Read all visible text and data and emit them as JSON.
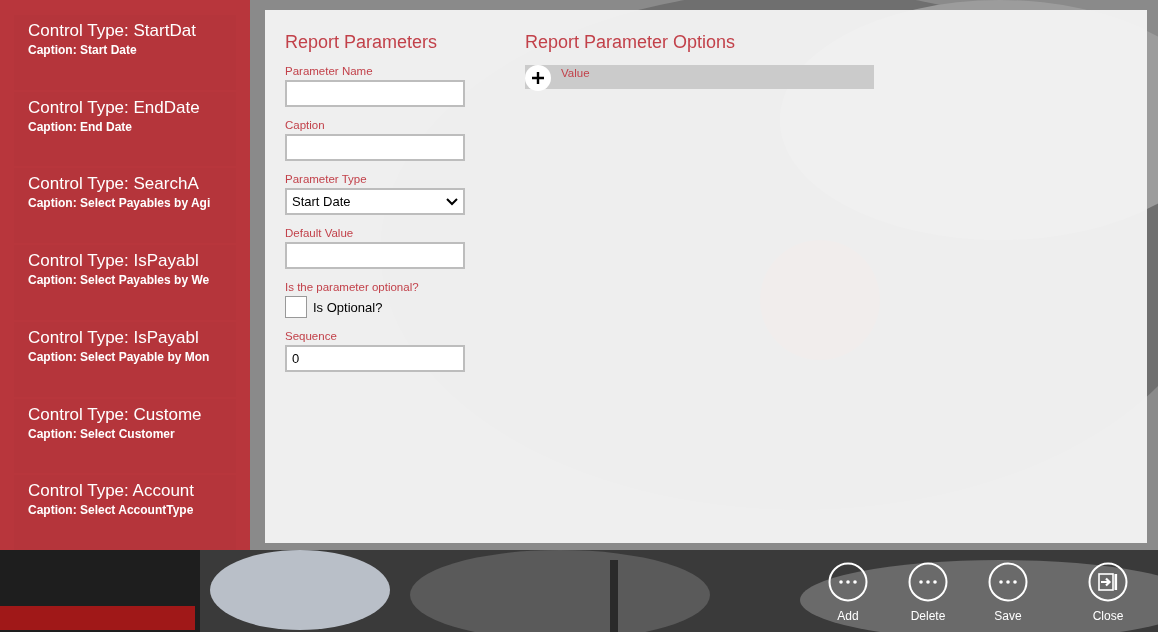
{
  "parameter_list": [
    {
      "control_type": "Control Type: StartDat",
      "caption": "Caption: Start Date",
      "selected": false
    },
    {
      "control_type": "Control Type: EndDate",
      "caption": "Caption: End Date",
      "selected": false
    },
    {
      "control_type": "Control Type: SearchA",
      "caption": "Caption: Select Payables by Agi",
      "selected": false
    },
    {
      "control_type": "Control Type: IsPayabl",
      "caption": "Caption: Select Payables by We",
      "selected": false
    },
    {
      "control_type": "Control Type: IsPayabl",
      "caption": "Caption: Select Payable by Mon",
      "selected": false
    },
    {
      "control_type": "Control Type: Custome",
      "caption": "Caption: Select Customer",
      "selected": false
    },
    {
      "control_type": "Control Type: Account",
      "caption": "Caption: Select AccountType",
      "selected": false
    }
  ],
  "report_parameters": {
    "title": "Report Parameters",
    "fields": [
      {
        "kind": "text",
        "label": "Parameter Name"
      },
      {
        "kind": "text",
        "label": "Caption"
      },
      {
        "kind": "select",
        "label": "Parameter Type",
        "value": "Start Date"
      },
      {
        "kind": "text",
        "label": "Default Value"
      },
      {
        "kind": "checkbox",
        "label": "Is the parameter optional?",
        "option": "Is Optional?",
        "checked": false
      },
      {
        "kind": "text",
        "label": "Sequence",
        "value": "0"
      }
    ]
  },
  "report_parameter_options": {
    "title": "Report Parameter Options",
    "columns": [
      "Value"
    ]
  },
  "app_bar": [
    {
      "kind": "more",
      "label": "Add"
    },
    {
      "kind": "more",
      "label": "Delete"
    },
    {
      "kind": "more",
      "label": "Save"
    },
    {
      "kind": "close",
      "label": "Close"
    }
  ]
}
